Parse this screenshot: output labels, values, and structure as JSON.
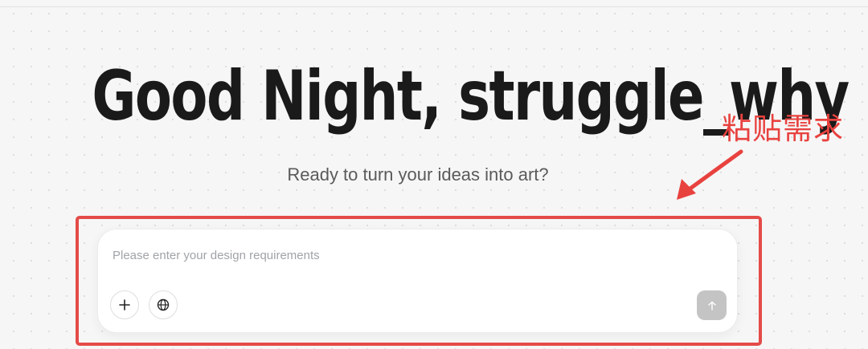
{
  "hero": {
    "greeting": "Good Night,  struggle_why",
    "subtitle": "Ready to turn your ideas into art?"
  },
  "prompt": {
    "placeholder": "Please enter your design requirements",
    "value": ""
  },
  "toolbar": {
    "add_icon": "plus-icon",
    "web_icon": "globe-icon",
    "send_icon": "arrow-up-icon"
  },
  "annotation": {
    "label": "粘贴需求",
    "color": "#e8423f"
  },
  "colors": {
    "background": "#f6f6f6",
    "heading": "#1a1a1a",
    "send_button_disabled": "#c4c4c4",
    "highlight": "#e44b48"
  }
}
